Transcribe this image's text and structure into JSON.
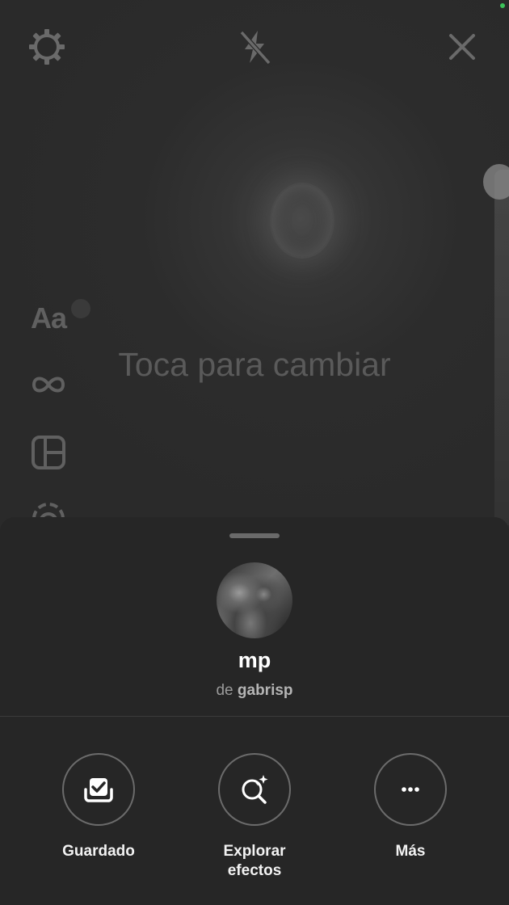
{
  "camera": {
    "hint_text": "Toca para cambiar",
    "top_bar": {
      "settings_icon": "gear-icon",
      "flash_icon": "flash-off-icon",
      "close_icon": "close-icon"
    },
    "tools": [
      {
        "name": "text-tool",
        "label": "Aa"
      },
      {
        "name": "boomerang-tool",
        "icon": "infinity-icon"
      },
      {
        "name": "layout-tool",
        "icon": "layout-icon"
      },
      {
        "name": "superzoom-tool",
        "icon": "superzoom-icon"
      }
    ]
  },
  "effect": {
    "name": "mp",
    "creator_prefix": "de",
    "creator": "gabrisp"
  },
  "actions": [
    {
      "label": "Guardado",
      "icon": "saved-icon"
    },
    {
      "label": "Explorar efectos",
      "icon": "explore-effects-icon"
    },
    {
      "label": "Más",
      "icon": "more-icon"
    }
  ],
  "colors": {
    "background": "#262626",
    "status_dot": "#3cc25a"
  }
}
